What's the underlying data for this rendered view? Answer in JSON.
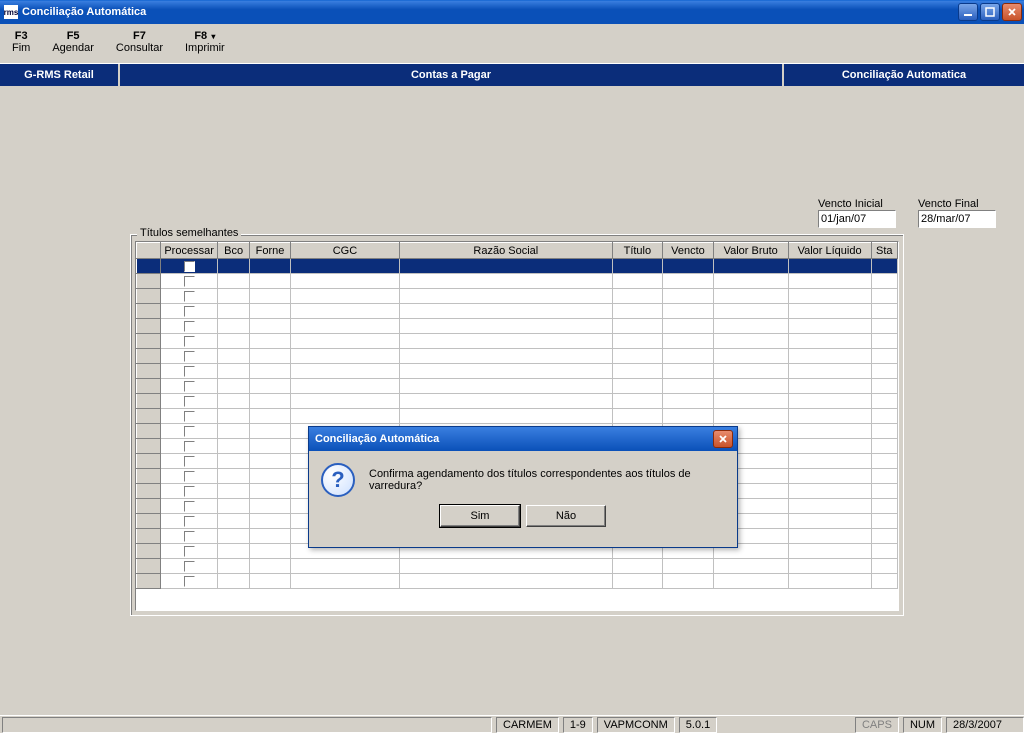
{
  "window": {
    "title": "Conciliação Automática"
  },
  "toolbar": {
    "items": [
      {
        "key": "F3",
        "label": "Fim"
      },
      {
        "key": "F5",
        "label": "Agendar"
      },
      {
        "key": "F7",
        "label": "Consultar"
      },
      {
        "key": "F8",
        "label": "Imprimir"
      }
    ]
  },
  "headerband": {
    "left": "G-RMS Retail",
    "center": "Contas a Pagar",
    "right": "Conciliação Automatica"
  },
  "filters": {
    "vencto_inicial": {
      "label": "Vencto Inicial",
      "value": "01/jan/07"
    },
    "vencto_final": {
      "label": "Vencto Final",
      "value": "28/mar/07"
    }
  },
  "grid": {
    "legend": "Títulos semelhantes",
    "columns": [
      "",
      "Processar",
      "Bco",
      "Forne",
      "CGC",
      "Razão Social",
      "Título",
      "Vencto",
      "Valor Bruto",
      "Valor Líquido",
      "Sta"
    ],
    "row_count": 22
  },
  "dialog": {
    "title": "Conciliação Automática",
    "message": "Confirma agendamento dos títulos correspondentes aos títulos de varredura?",
    "yes_label": "Sim",
    "no_label": "Não"
  },
  "status": {
    "user": "CARMEM",
    "pages": "1-9",
    "program": "VAPMCONM",
    "version": "5.0.1",
    "caps": "CAPS",
    "num": "NUM",
    "date": "28/3/2007"
  }
}
